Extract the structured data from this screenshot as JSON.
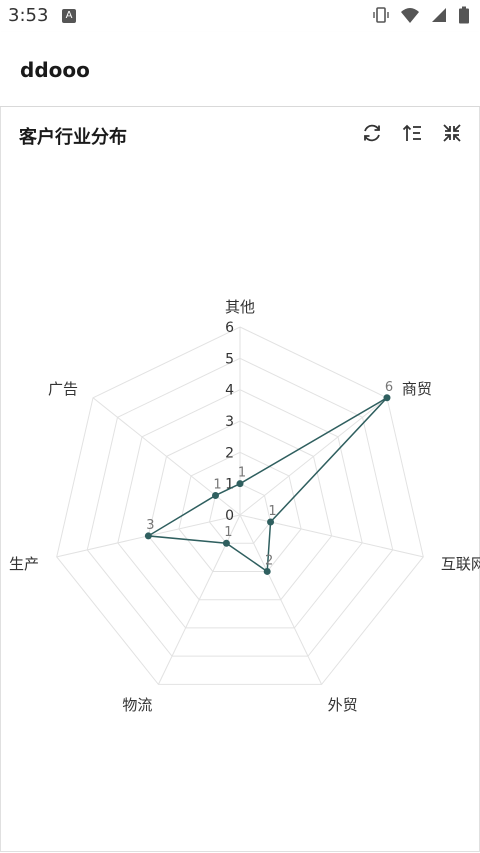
{
  "status_bar": {
    "time": "3:53",
    "notification_icon": "A",
    "icons": [
      "vibrate-icon",
      "wifi-icon",
      "signal-icon",
      "battery-icon"
    ]
  },
  "app_bar": {
    "title": "ddooo"
  },
  "card": {
    "title": "客户行业分布",
    "tools": [
      "refresh-icon",
      "sort-icon",
      "collapse-icon"
    ]
  },
  "colors": {
    "series": "#2f5f5f",
    "grid": "#e2e2e2"
  },
  "chart_data": {
    "type": "radar",
    "indicators": [
      "其他",
      "商贸",
      "互联网",
      "外贸",
      "物流",
      "生产",
      "广告"
    ],
    "values": [
      1,
      6,
      1,
      2,
      1,
      3,
      1
    ],
    "rmax": 6,
    "ticks": [
      "0",
      "1",
      "2",
      "3",
      "4",
      "5",
      "6"
    ]
  }
}
